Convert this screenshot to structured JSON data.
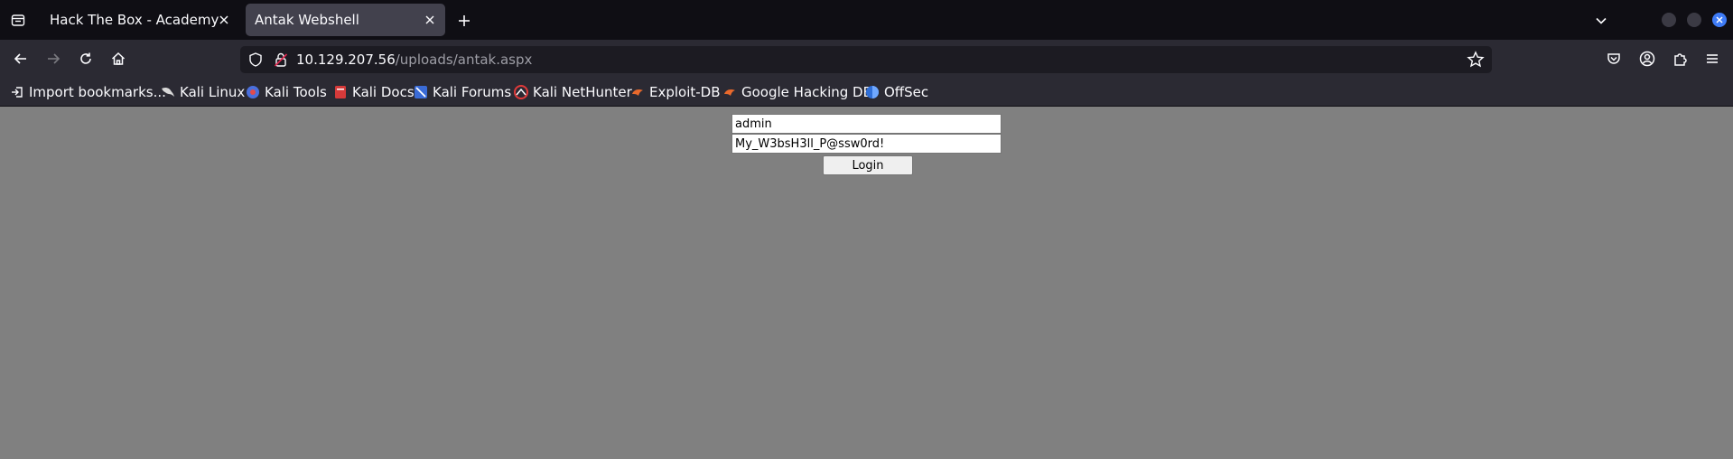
{
  "tabs": [
    {
      "label": "Hack The Box - Academy"
    },
    {
      "label": "Antak Webshell"
    }
  ],
  "address": {
    "host": "10.129.207.56",
    "path": "/uploads/antak.aspx"
  },
  "bookmarks": [
    {
      "label": "Import bookmarks...",
      "icon": "import-icon"
    },
    {
      "label": "Kali Linux",
      "icon": "kali-dragon-icon"
    },
    {
      "label": "Kali Tools",
      "icon": "kali-tools-icon"
    },
    {
      "label": "Kali Docs",
      "icon": "kali-docs-icon"
    },
    {
      "label": "Kali Forums",
      "icon": "kali-forums-icon"
    },
    {
      "label": "Kali NetHunter",
      "icon": "kali-nethunter-icon"
    },
    {
      "label": "Exploit-DB",
      "icon": "exploit-db-icon"
    },
    {
      "label": "Google Hacking DB",
      "icon": "ghdb-icon"
    },
    {
      "label": "OffSec",
      "icon": "offsec-icon"
    }
  ],
  "form": {
    "username": "admin",
    "password": "My_W3bsH3ll_P@ssw0rd!",
    "login_label": "Login"
  },
  "colors": {
    "accent": "#3e7bf6",
    "page_bg": "#808080"
  }
}
